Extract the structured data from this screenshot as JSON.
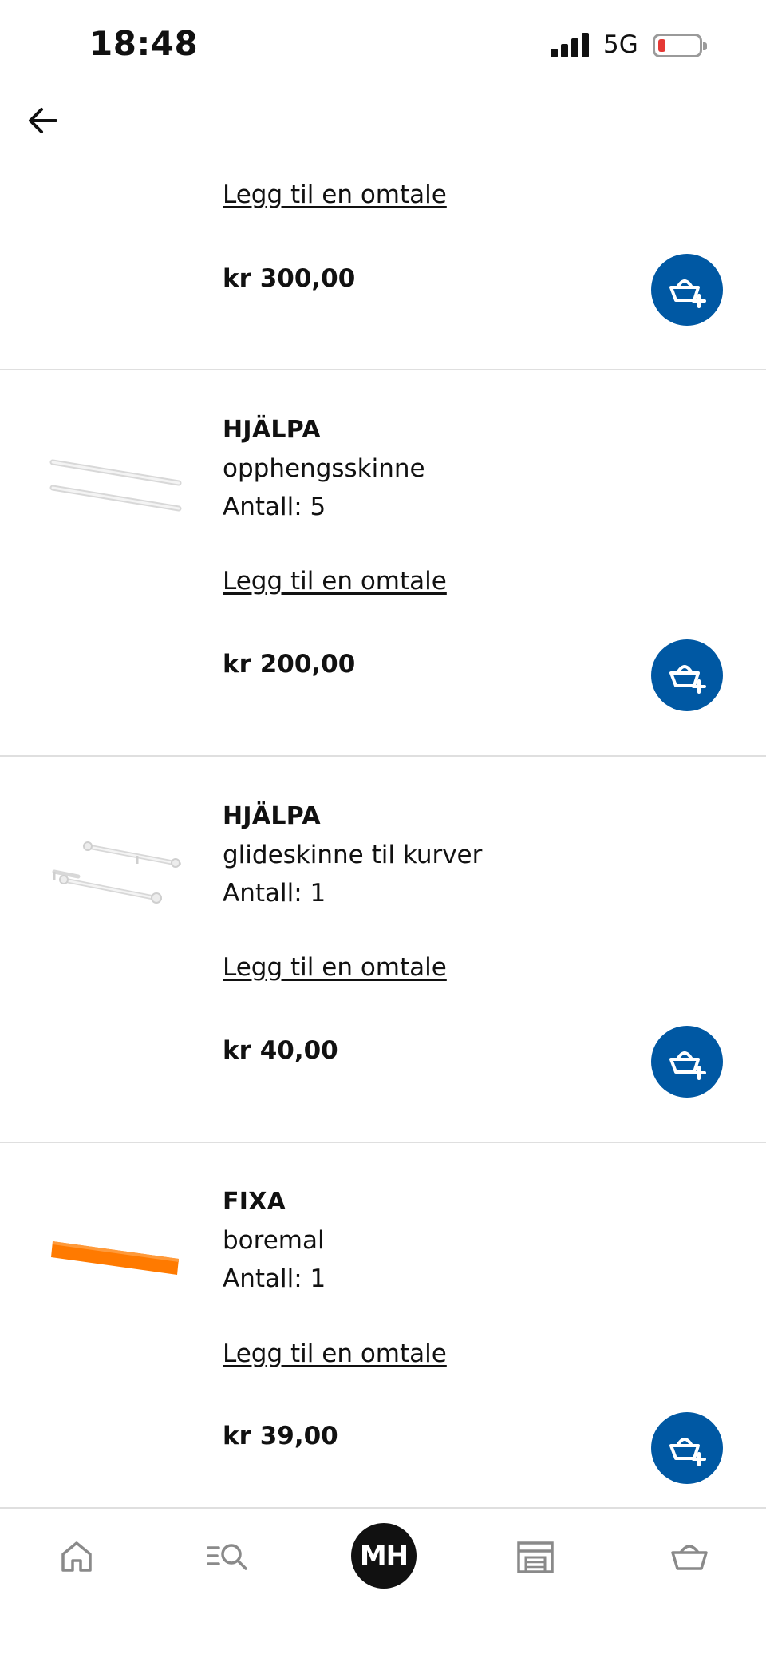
{
  "status_bar": {
    "time": "18:48",
    "network": "5G"
  },
  "items": [
    {
      "review_label": "Legg til en omtale",
      "price": "kr 300,00"
    },
    {
      "brand": "HJÄLPA",
      "description": "opphengsskinne",
      "quantity": "Antall: 5",
      "review_label": "Legg til en omtale",
      "price": "kr 200,00"
    },
    {
      "brand": "HJÄLPA",
      "description": "glideskinne til kurver",
      "quantity": "Antall: 1",
      "review_label": "Legg til en omtale",
      "price": "kr 40,00"
    },
    {
      "brand": "FIXA",
      "description": "boremal",
      "quantity": "Antall: 1",
      "review_label": "Legg til en omtale",
      "price": "kr 39,00"
    }
  ],
  "bottom_nav": {
    "items": [
      "home-icon",
      "search-icon",
      "profile-avatar",
      "store-icon",
      "basket-icon"
    ],
    "avatar_initials": "MH"
  },
  "colors": {
    "accent": "#0058a3",
    "battery_low": "#e53935",
    "product_orange": "#ff7a00"
  }
}
